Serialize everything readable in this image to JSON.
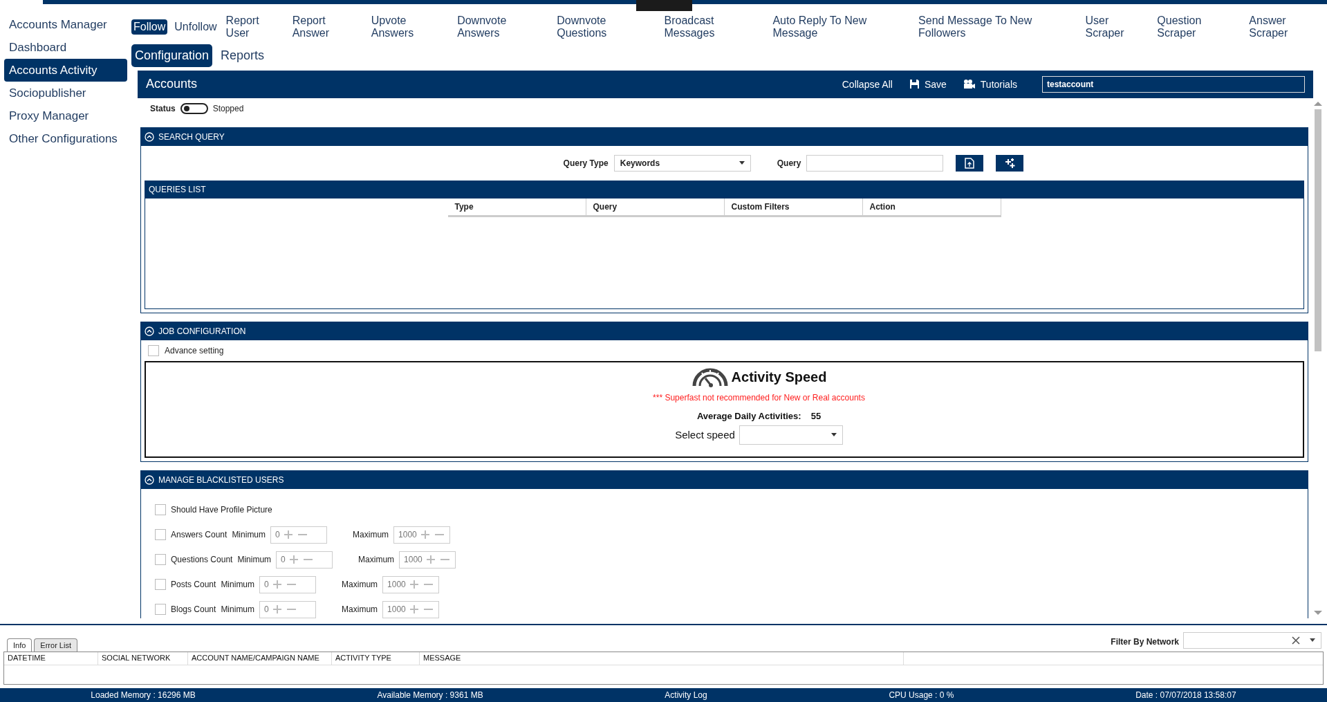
{
  "sidebar": {
    "items": [
      {
        "label": "Accounts Manager",
        "selected": false
      },
      {
        "label": "Dashboard",
        "selected": false
      },
      {
        "label": "Accounts Activity",
        "selected": true
      },
      {
        "label": "Sociopublisher",
        "selected": false
      },
      {
        "label": "Proxy Manager",
        "selected": false
      },
      {
        "label": "Other Configurations",
        "selected": false
      }
    ]
  },
  "tabs": [
    {
      "label": "Follow",
      "selected": true
    },
    {
      "label": "Unfollow",
      "selected": false
    },
    {
      "label": "Report User",
      "selected": false
    },
    {
      "label": "Report Answer",
      "selected": false
    },
    {
      "label": "Upvote Answers",
      "selected": false
    },
    {
      "label": "Downvote Answers",
      "selected": false
    },
    {
      "label": "Downvote Questions",
      "selected": false
    },
    {
      "label": "Broadcast Messages",
      "selected": false
    },
    {
      "label": "Auto Reply To New Message",
      "selected": false
    },
    {
      "label": "Send Message To New Followers",
      "selected": false
    },
    {
      "label": "User Scraper",
      "selected": false
    },
    {
      "label": "Question Scraper",
      "selected": false
    },
    {
      "label": "Answer Scraper",
      "selected": false
    }
  ],
  "subtabs": [
    {
      "label": "Configuration",
      "selected": true
    },
    {
      "label": "Reports",
      "selected": false
    }
  ],
  "header": {
    "title": "Accounts",
    "actions": [
      {
        "kind": "collapse",
        "label": "Collapse All"
      },
      {
        "kind": "save",
        "label": "Save"
      },
      {
        "kind": "tutorials",
        "label": "Tutorials"
      }
    ],
    "account": "testaccount"
  },
  "status": {
    "label": "Status",
    "on": false,
    "text": "Stopped"
  },
  "search_query": {
    "title": "SEARCH QUERY",
    "query_type_label": "Query Type",
    "query_type": "Keywords",
    "query_label": "Query",
    "queries_list": {
      "title": "QUERIES LIST",
      "columns": [
        "Type",
        "Query",
        "Custom Filters",
        "Action"
      ]
    }
  },
  "job_configuration": {
    "title": "JOB CONFIGURATION",
    "advance_setting": {
      "label": "Advance setting",
      "checked": false
    },
    "activity_speed": {
      "title": "Activity Speed",
      "warning": "*** Superfast not recommended for New or Real accounts",
      "average_label": "Average Daily Activities:",
      "average_value": "55",
      "select_label": "Select speed"
    }
  },
  "blacklist": {
    "title": "MANAGE BLACKLISTED USERS",
    "rows": [
      {
        "kind": "check",
        "label": "Should Have Profile Picture",
        "checked": false
      },
      {
        "kind": "range",
        "label": "Answers Count",
        "checked": false,
        "min_label": "Minimum",
        "min": "0",
        "max_label": "Maximum",
        "max": "1000"
      },
      {
        "kind": "range",
        "label": "Questions Count",
        "checked": false,
        "min_label": "Minimum",
        "min": "0",
        "max_label": "Maximum",
        "max": "1000"
      },
      {
        "kind": "range",
        "label": "Posts Count",
        "checked": false,
        "min_label": "Minimum",
        "min": "0",
        "max_label": "Maximum",
        "max": "1000"
      },
      {
        "kind": "range",
        "label": "Blogs Count",
        "checked": false,
        "min_label": "Minimum",
        "min": "0",
        "max_label": "Maximum",
        "max": "1000"
      }
    ]
  },
  "log": {
    "tabs": [
      {
        "label": "Info",
        "selected": true
      },
      {
        "label": "Error List",
        "selected": false
      }
    ],
    "filter_label": "Filter By Network",
    "columns": [
      "DATETIME",
      "SOCIAL NETWORK",
      "ACCOUNT NAME/CAMPAIGN NAME",
      "ACTIVITY TYPE",
      "MESSAGE"
    ]
  },
  "status_bar": [
    "Loaded Memory : 16296 MB",
    "Available Memory : 9361  MB",
    "Activity Log",
    "CPU Usage : 0 %",
    "Date : 07/07/2018 13:58:07"
  ]
}
